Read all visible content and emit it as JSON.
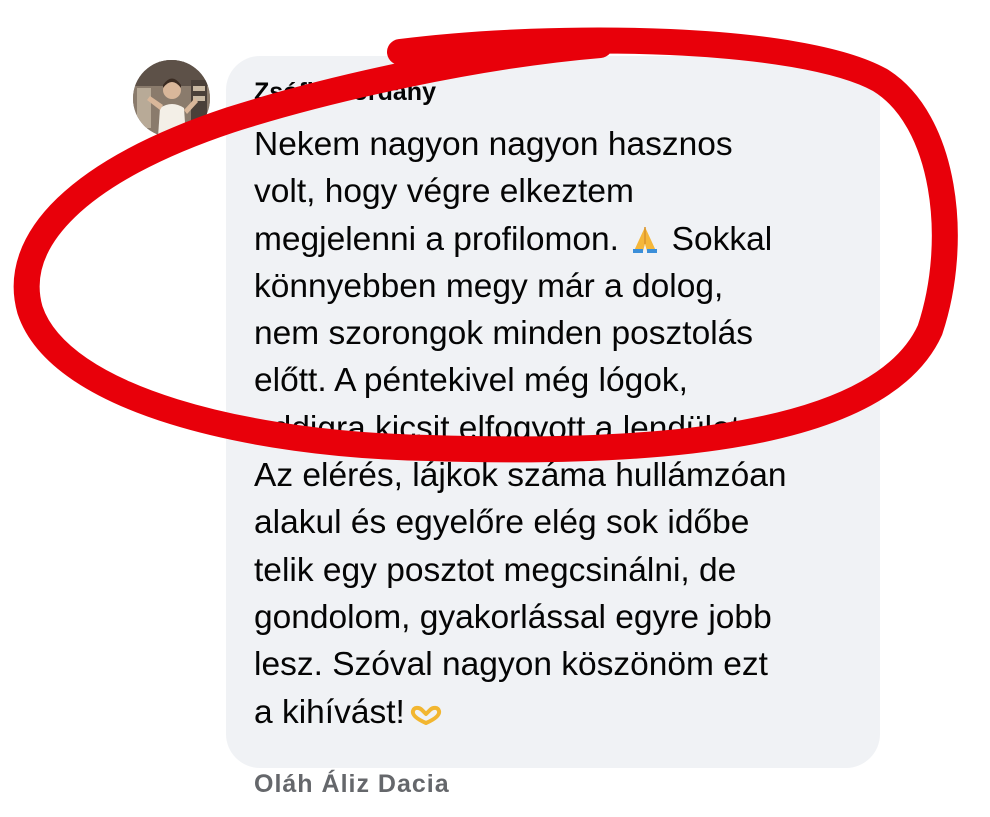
{
  "top_hint": "· · ·",
  "comment": {
    "author": "Zsófia Hordány",
    "lines": [
      "Nekem nagyon nagyon hasznos",
      "volt, hogy végre elkeztem",
      "megjelenni a profilomon.",
      "Sokkal",
      "könnyebben megy már a dolog,",
      "nem szorongok minden posztolás",
      "előtt. A péntekivel még lógok,",
      "addigra kicsit elfogyott a lendület.",
      "Az elérés, lájkok száma hullámzóan",
      "alakul és egyelőre elég sok időbe",
      "telik egy posztot megcsinálni, de",
      "gondolom, gyakorlással egyre jobb",
      "lesz. Szóval nagyon köszönöm ezt",
      "a kihívást!"
    ],
    "emojis": [
      "folded-hands",
      "heart-hands"
    ]
  },
  "next_comment_author": "Oláh Áliz Dacia",
  "colors": {
    "bubble": "#f0f2f5",
    "text": "#050505",
    "annotation_stroke": "#e8000a"
  }
}
